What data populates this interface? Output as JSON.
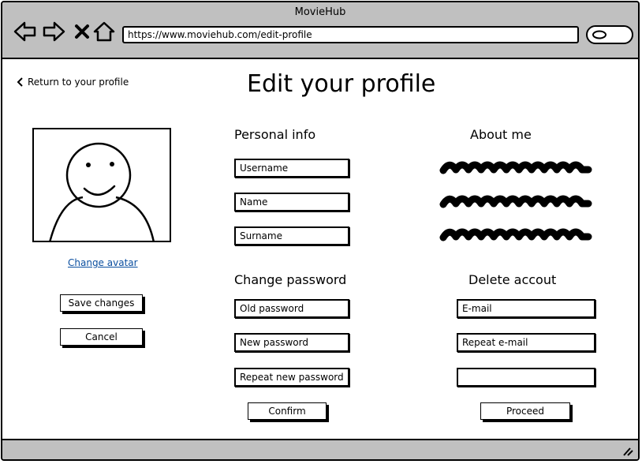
{
  "window": {
    "title": "MovieHub"
  },
  "browser": {
    "url": "https://www.moviehub.com/edit-profile",
    "nav_icons": [
      "back-arrow-icon",
      "forward-arrow-icon",
      "close-x-icon",
      "home-icon"
    ],
    "search_icon": "search-icon"
  },
  "page": {
    "back_link": "Return to your profile",
    "title": "Edit your profile"
  },
  "avatar": {
    "change_link": "Change avatar",
    "save_button": "Save changes",
    "cancel_button": "Cancel"
  },
  "personal_info": {
    "heading": "Personal info",
    "fields": [
      "Username",
      "Name",
      "Surname"
    ]
  },
  "about_me": {
    "heading": "About me"
  },
  "change_password": {
    "heading": "Change password",
    "fields": [
      "Old password",
      "New password",
      "Repeat new password"
    ],
    "confirm_button": "Confirm"
  },
  "delete_account": {
    "heading": "Delete accout",
    "fields": [
      "E-mail",
      "Repeat e-mail",
      ""
    ],
    "proceed_button": "Proceed"
  },
  "colors": {
    "chrome": "#c0c0c0",
    "link": "#0b4fa0"
  }
}
